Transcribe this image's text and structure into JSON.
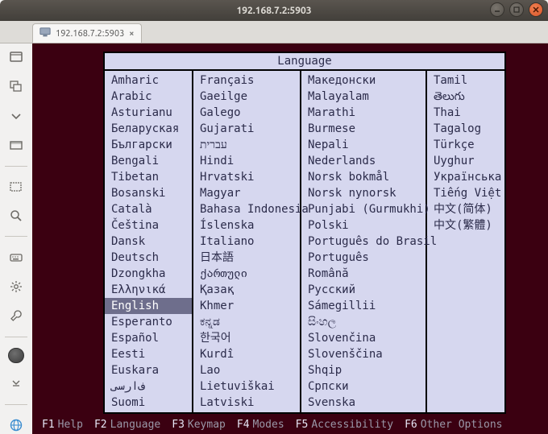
{
  "window": {
    "title": "192.168.7.2:5903"
  },
  "tab": {
    "label": "192.168.7.2:5903"
  },
  "lang_header": "Language",
  "selected_language": "English",
  "columns": [
    [
      "Amharic",
      "Arabic",
      "Asturianu",
      "Беларуская",
      "Български",
      "Bengali",
      "Tibetan",
      "Bosanski",
      "Català",
      "Čeština",
      "Dansk",
      "Deutsch",
      "Dzongkha",
      "Ελληνικά",
      "English",
      "Esperanto",
      "Español",
      "Eesti",
      "Euskara",
      "ﻑﺍﺭﺳﯽ",
      "Suomi"
    ],
    [
      "Français",
      "Gaeilge",
      "Galego",
      "Gujarati",
      "עברית",
      "Hindi",
      "Hrvatski",
      "Magyar",
      "Bahasa Indonesia",
      "Íslenska",
      "Italiano",
      "日本語",
      "ქართული",
      "Қазақ",
      "Khmer",
      "ಕನ್ನಡ",
      "한국어",
      "Kurdî",
      "Lao",
      "Lietuviškai",
      "Latviski"
    ],
    [
      "Македонски",
      "Malayalam",
      "Marathi",
      "Burmese",
      "Nepali",
      "Nederlands",
      "Norsk bokmål",
      "Norsk nynorsk",
      "Punjabi (Gurmukhi)",
      "Polski",
      "Português do Brasil",
      "Português",
      "Română",
      "Русский",
      "Sámegillii",
      "සිංහල",
      "Slovenčina",
      "Slovenščina",
      "Shqip",
      "Српски",
      "Svenska"
    ],
    [
      "Tamil",
      "తెలుగు",
      "Thai",
      "Tagalog",
      "Türkçe",
      "Uyghur",
      "Українська",
      "Tiếng Việt",
      "中文(简体)",
      "中文(繁體)"
    ]
  ],
  "fkeys": [
    {
      "key": "F1",
      "label": "Help"
    },
    {
      "key": "F2",
      "label": "Language"
    },
    {
      "key": "F3",
      "label": "Keymap"
    },
    {
      "key": "F4",
      "label": "Modes"
    },
    {
      "key": "F5",
      "label": "Accessibility"
    },
    {
      "key": "F6",
      "label": "Other Options"
    }
  ]
}
